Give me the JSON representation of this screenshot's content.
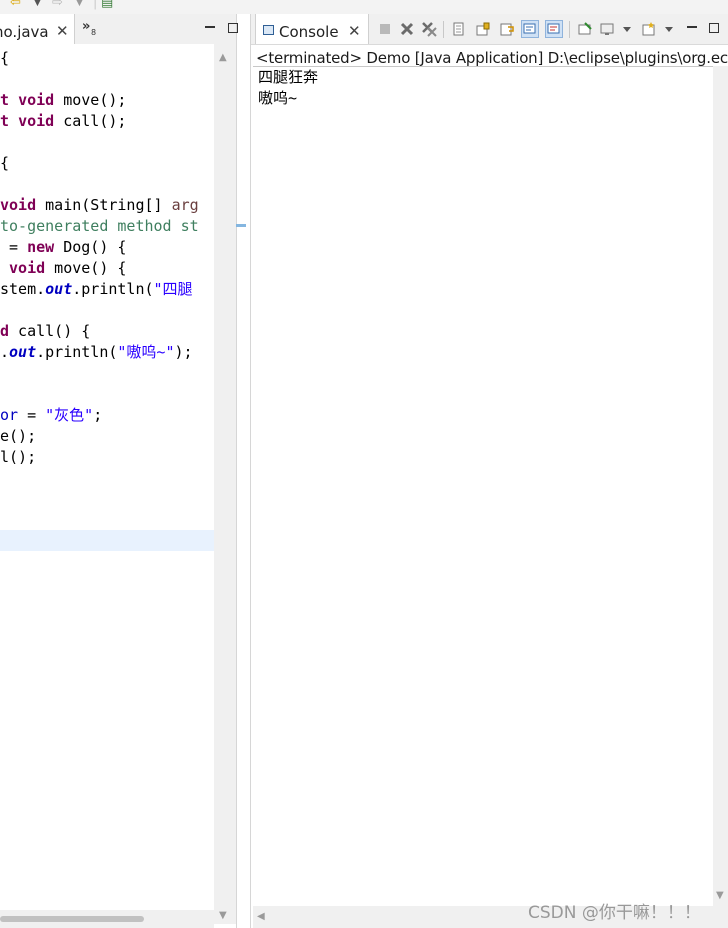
{
  "toolbar": {
    "icons": [
      "back-arrow-icon",
      "forward-arrow-icon",
      "new-file-icon"
    ]
  },
  "editor": {
    "tab_label": "no.java",
    "tab_close": "✕",
    "overflow": "»",
    "overflow_count": "8",
    "code_lines": [
      "{",
      "",
      "t void move();",
      "t void call();",
      "",
      "{",
      "",
      "void main(String[] arg",
      "to-generated method st",
      " = new Dog() {",
      " void move() {",
      "stem.out.println(\"四腿",
      "",
      "d call() {",
      ".out.println(\"嗷呜~\");",
      "",
      "",
      "or = \"灰色\";",
      "e();",
      "l();"
    ]
  },
  "console": {
    "tab_label": "Console",
    "tab_close": "✕",
    "process_label": "<terminated> Demo [Java Application] D:\\eclipse\\plugins\\org.ecl",
    "output_lines": [
      "四腿狂奔",
      "嗷呜~"
    ],
    "toolbar_icons": [
      "terminate-icon",
      "remove-launch-icon",
      "remove-all-icon",
      "clear-console-icon",
      "scroll-lock-icon",
      "word-wrap-icon",
      "show-stdout-icon",
      "show-stderr-icon",
      "pin-console-icon",
      "display-console-icon",
      "open-console-icon"
    ]
  },
  "watermark": "CSDN @你干嘛！！！"
}
